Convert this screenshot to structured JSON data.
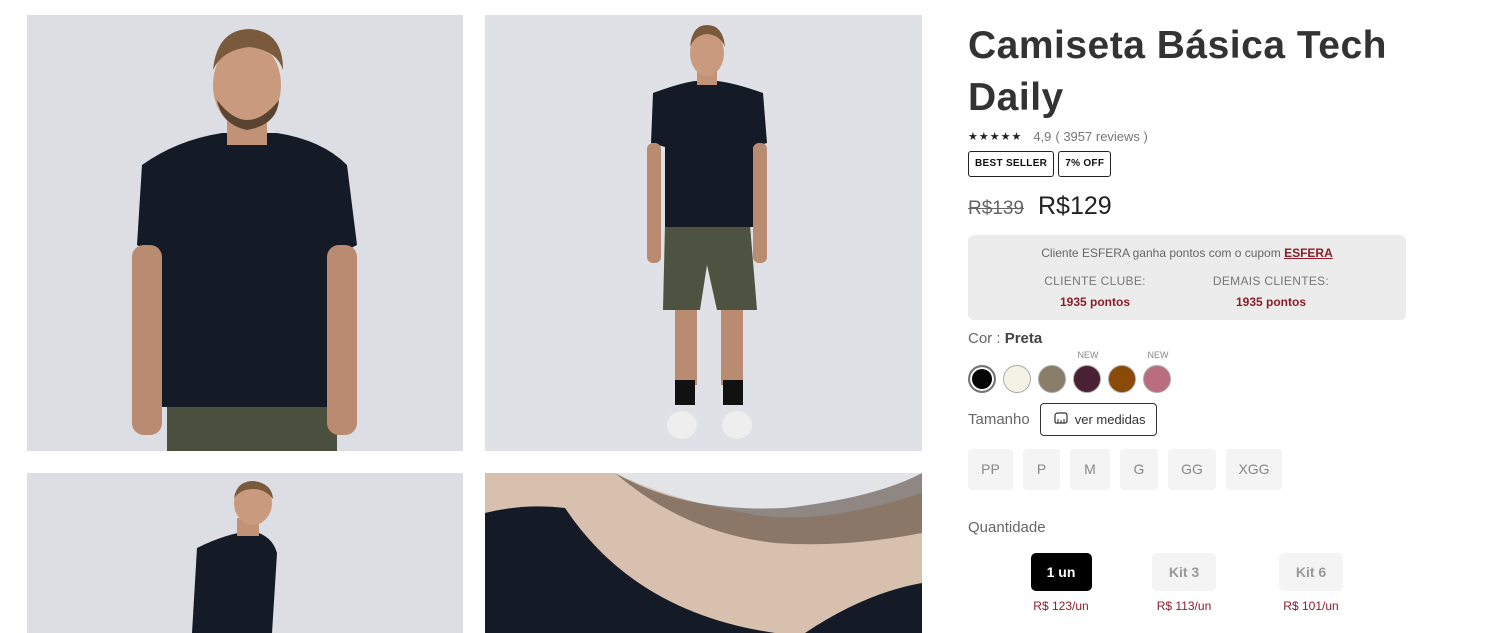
{
  "product": {
    "title": "Camiseta Básica Tech Daily",
    "rating_stars": "★★★★★",
    "rating": "4,9",
    "reviews": "( 3957 reviews )",
    "badges": [
      "BEST SELLER",
      "7% OFF"
    ],
    "old_price": "R$139",
    "price": "R$129"
  },
  "esfera": {
    "text": "Cliente ESFERA ganha pontos com o cupom",
    "code": "ESFERA",
    "club_label": "CLIENTE CLUBE:",
    "club_points": "1935 pontos",
    "others_label": "DEMAIS CLIENTES:",
    "others_points": "1935 pontos"
  },
  "color": {
    "label": "Cor :",
    "selected": "Preta",
    "swatches": [
      {
        "name": "preta",
        "hex": "#050505",
        "tag": "",
        "selected": true
      },
      {
        "name": "off-white",
        "hex": "#f3f2e4",
        "tag": "",
        "selected": false
      },
      {
        "name": "taupe",
        "hex": "#8a7e6b",
        "tag": "",
        "selected": false
      },
      {
        "name": "vinho",
        "hex": "#4a2035",
        "tag": "NEW",
        "selected": false
      },
      {
        "name": "caramelo",
        "hex": "#8a4a08",
        "tag": "",
        "selected": false
      },
      {
        "name": "rosa",
        "hex": "#b86e7e",
        "tag": "NEW",
        "selected": false
      }
    ]
  },
  "size": {
    "label": "Tamanho",
    "guide_label": "ver medidas",
    "options": [
      "PP",
      "P",
      "M",
      "G",
      "GG",
      "XGG"
    ]
  },
  "quantity": {
    "label": "Quantidade",
    "kits": [
      {
        "label": "1 un",
        "per_unit": "R$ 123/un",
        "selected": true
      },
      {
        "label": "Kit 3",
        "per_unit": "R$ 113/un",
        "selected": false
      },
      {
        "label": "Kit 6",
        "per_unit": "R$ 101/un",
        "selected": false
      }
    ]
  },
  "colors": {
    "accent": "#8a1c2c",
    "panel": "#ececec",
    "shirt": "#141a26"
  },
  "icons": {
    "ruler": "ruler-icon"
  }
}
